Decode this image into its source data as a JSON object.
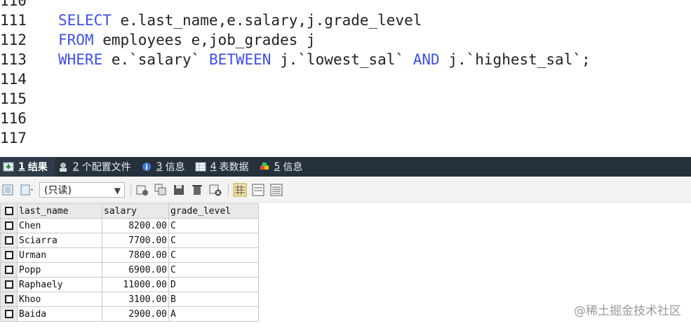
{
  "editor": {
    "lines": [
      {
        "num": "110",
        "code": []
      },
      {
        "num": "111",
        "code": [
          {
            "kw": true,
            "t": "SELECT"
          },
          {
            "kw": false,
            "t": " e.last_name,e.salary,j.grade_level"
          }
        ]
      },
      {
        "num": "112",
        "code": [
          {
            "kw": true,
            "t": "FROM"
          },
          {
            "kw": false,
            "t": " employees e,job_grades j"
          }
        ]
      },
      {
        "num": "113",
        "code": [
          {
            "kw": true,
            "t": "WHERE"
          },
          {
            "kw": false,
            "t": " e.`salary` "
          },
          {
            "kw": true,
            "t": "BETWEEN"
          },
          {
            "kw": false,
            "t": " j.`lowest_sal` "
          },
          {
            "kw": true,
            "t": "AND"
          },
          {
            "kw": false,
            "t": " j.`highest_sal`;"
          }
        ]
      },
      {
        "num": "114",
        "code": []
      },
      {
        "num": "115",
        "code": []
      },
      {
        "num": "116",
        "code": []
      },
      {
        "num": "117",
        "code": []
      }
    ]
  },
  "tabs": [
    {
      "num": "1",
      "label": "结果",
      "icon": "result-grid-icon",
      "active": true
    },
    {
      "num": "2",
      "label": "个配置文件",
      "icon": "profile-icon",
      "active": false
    },
    {
      "num": "3",
      "label": "信息",
      "icon": "info-icon",
      "active": false
    },
    {
      "num": "4",
      "label": "表数据",
      "icon": "table-data-icon",
      "active": false
    },
    {
      "num": "5",
      "label": "信息",
      "icon": "info-puzzle-icon",
      "active": false
    }
  ],
  "toolbar": {
    "mode_select": "(只读)"
  },
  "grid": {
    "columns": [
      "last_name",
      "salary",
      "grade_level"
    ],
    "rows": [
      [
        "Chen",
        "8200.00",
        "C"
      ],
      [
        "Sciarra",
        "7700.00",
        "C"
      ],
      [
        "Urman",
        "7800.00",
        "C"
      ],
      [
        "Popp",
        "6900.00",
        "C"
      ],
      [
        "Raphaely",
        "11000.00",
        "D"
      ],
      [
        "Khoo",
        "3100.00",
        "B"
      ],
      [
        "Baida",
        "2900.00",
        "A"
      ]
    ]
  },
  "watermark": "@稀土掘金技术社区",
  "colors": {
    "keyword": "#3d50e8",
    "tab_bar": "#26313d"
  }
}
